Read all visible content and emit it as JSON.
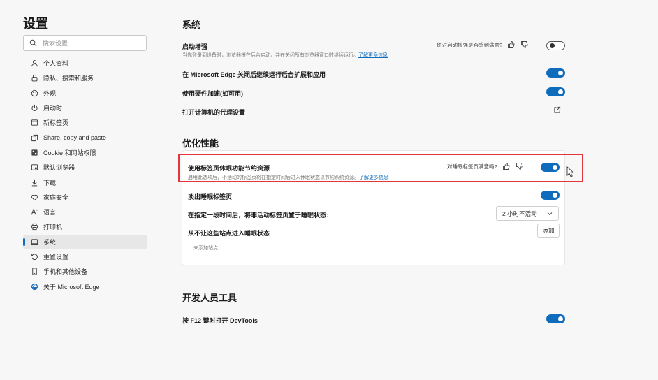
{
  "sidebar": {
    "title": "设置",
    "search_placeholder": "搜索设置",
    "items": [
      {
        "label": "个人资料",
        "icon": "profile-icon"
      },
      {
        "label": "隐私、搜索和服务",
        "icon": "lock-icon"
      },
      {
        "label": "外观",
        "icon": "appearance-icon"
      },
      {
        "label": "启动时",
        "icon": "power-icon"
      },
      {
        "label": "新标签页",
        "icon": "new-tab-icon"
      },
      {
        "label": "Share, copy and paste",
        "icon": "share-icon"
      },
      {
        "label": "Cookie 和网站权限",
        "icon": "cookie-icon"
      },
      {
        "label": "默认浏览器",
        "icon": "browser-icon"
      },
      {
        "label": "下载",
        "icon": "download-icon"
      },
      {
        "label": "家庭安全",
        "icon": "family-icon"
      },
      {
        "label": "语言",
        "icon": "language-icon"
      },
      {
        "label": "打印机",
        "icon": "printer-icon"
      },
      {
        "label": "系统",
        "icon": "system-icon",
        "active": true
      },
      {
        "label": "重置设置",
        "icon": "reset-icon"
      },
      {
        "label": "手机和其他设备",
        "icon": "phone-icon"
      },
      {
        "label": "关于 Microsoft Edge",
        "icon": "edge-icon"
      }
    ]
  },
  "system": {
    "title": "系统",
    "startup_boost": {
      "title": "启动增强",
      "desc": "当你登录到设备时，浏览器将在后台启动，并在关闭所有浏览器窗口时继续运行。",
      "link": "了解更多信息",
      "feedback": "你对启动增强是否感到满意?",
      "enabled": false
    },
    "background_apps": {
      "title": "在 Microsoft Edge 关闭后继续运行后台扩展和应用",
      "enabled": true
    },
    "hardware_accel": {
      "title": "使用硬件加速(如可用)",
      "enabled": true
    },
    "proxy": {
      "title": "打开计算机的代理设置"
    }
  },
  "performance": {
    "title": "优化性能",
    "sleeping_tabs": {
      "title": "使用标签页休眠功能节约资源",
      "desc": "启用此选项后，不活动的标签页将在指定时间后进入休眠状态以节约系统资源。",
      "link": "了解更多信息",
      "feedback": "对睡眠标签页满意吗?",
      "enabled": true
    },
    "fade_tabs": {
      "title": "淡出睡眠标签页",
      "enabled": true
    },
    "sleep_after": {
      "title": "在指定一段时间后，将非活动标签页置于睡眠状态:",
      "value": "2 小时不活动"
    },
    "never_sleep": {
      "title": "从不让这些站点进入睡眠状态",
      "add_label": "添加",
      "empty": "未添加站点"
    }
  },
  "developer": {
    "title": "开发人员工具",
    "f12": {
      "title": "按 F12 键时打开 DevTools",
      "enabled": true
    }
  },
  "colors": {
    "accent": "#0f6cbd",
    "highlight": "#e0383e"
  }
}
